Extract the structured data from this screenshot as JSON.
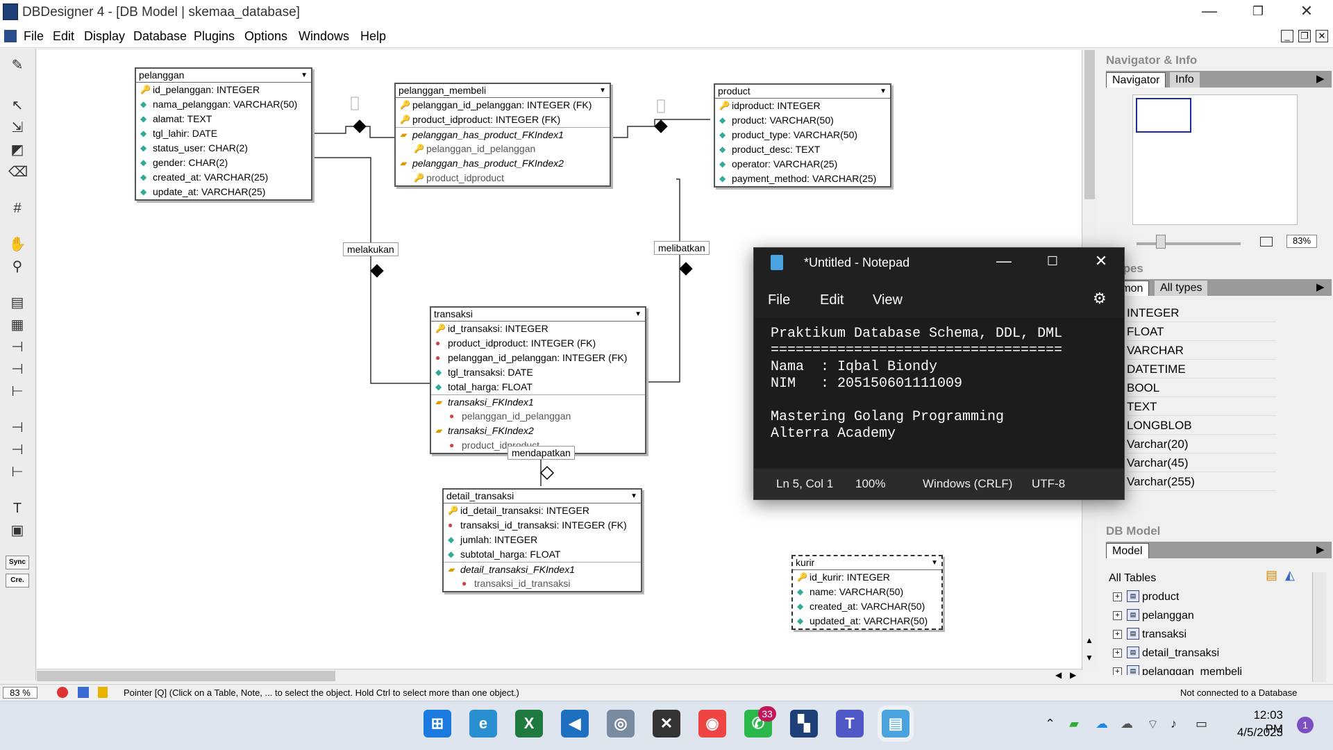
{
  "window": {
    "title": "DBDesigner 4 - [DB Model | skemaa_database]"
  },
  "menu": [
    "File",
    "Edit",
    "Display",
    "Database",
    "Plugins",
    "Options",
    "Windows",
    "Help"
  ],
  "tables": {
    "pelanggan": {
      "name": "pelanggan",
      "cols": [
        "id_pelanggan: INTEGER",
        "nama_pelanggan: VARCHAR(50)",
        "alamat: TEXT",
        "tgl_lahir: DATE",
        "status_user: CHAR(2)",
        "gender: CHAR(2)",
        "created_at: VARCHAR(25)",
        "update_at: VARCHAR(25)"
      ]
    },
    "pelanggan_membeli": {
      "name": "pelanggan_membeli",
      "cols": [
        "pelanggan_id_pelanggan: INTEGER (FK)",
        "product_idproduct: INTEGER (FK)",
        "pelanggan_has_product_FKIndex1",
        "pelanggan_id_pelanggan",
        "pelanggan_has_product_FKIndex2",
        "product_idproduct"
      ]
    },
    "product": {
      "name": "product",
      "cols": [
        "idproduct: INTEGER",
        "product: VARCHAR(50)",
        "product_type: VARCHAR(50)",
        "product_desc: TEXT",
        "operator: VARCHAR(25)",
        "payment_method: VARCHAR(25)"
      ]
    },
    "transaksi": {
      "name": "transaksi",
      "cols": [
        "id_transaksi: INTEGER",
        "product_idproduct: INTEGER (FK)",
        "pelanggan_id_pelanggan: INTEGER (FK)",
        "tgl_transaksi: DATE",
        "total_harga: FLOAT",
        "transaksi_FKIndex1",
        "pelanggan_id_pelanggan",
        "transaksi_FKIndex2",
        "product_idproduct"
      ]
    },
    "detail_transaksi": {
      "name": "detail_transaksi",
      "cols": [
        "id_detail_transaksi: INTEGER",
        "transaksi_id_transaksi: INTEGER (FK)",
        "jumlah: INTEGER",
        "subtotal_harga: FLOAT",
        "detail_transaksi_FKIndex1",
        "transaksi_id_transaksi"
      ]
    },
    "kurir": {
      "name": "kurir",
      "cols": [
        "id_kurir: INTEGER",
        "name: VARCHAR(50)",
        "created_at: VARCHAR(50)",
        "updated_at: VARCHAR(50)"
      ]
    }
  },
  "relations": {
    "r1": "melakukan",
    "r2": "melibatkan",
    "r3": "mendapatkan"
  },
  "toolbox": {
    "sync": "Sync",
    "crea": "Cre."
  },
  "status": {
    "zoom": "83 %",
    "hint": "Pointer [Q] (Click on a Table, Note, ... to select the object. Hold Ctrl to select more than one object.)",
    "conn": "Not connected to a Database"
  },
  "navigator": {
    "title": "Navigator & Info",
    "tab1": "Navigator",
    "tab2": "Info",
    "zoom": "83%"
  },
  "datatypes": {
    "title": "atypes",
    "tab1": "mmon",
    "tab2": "All types",
    "items": [
      "INTEGER",
      "FLOAT",
      "VARCHAR",
      "DATETIME",
      "BOOL",
      "TEXT",
      "LONGBLOB",
      "Varchar(20)",
      "Varchar(45)",
      "Varchar(255)"
    ]
  },
  "dbmodel": {
    "title": "DB Model",
    "tab": "Model",
    "all": "All Tables",
    "items": [
      "product",
      "pelanggan",
      "transaksi",
      "detail_transaksi",
      "pelanggan_membeli"
    ]
  },
  "notepad": {
    "title": "*Untitled - Notepad",
    "menu": [
      "File",
      "Edit",
      "View"
    ],
    "lines": [
      "Praktikum Database Schema, DDL, DML",
      "===================================",
      "Nama  : Iqbal Biondy",
      "NIM   : 205150601111009",
      "",
      "Mastering Golang Programming",
      "Alterra Academy"
    ],
    "status": {
      "pos": "Ln 5, Col 1",
      "zoom": "100%",
      "eol": "Windows (CRLF)",
      "enc": "UTF-8"
    }
  },
  "taskbar": {
    "time": "12:03 PM",
    "date": "4/5/2023",
    "badge": "33",
    "notif": "1"
  }
}
